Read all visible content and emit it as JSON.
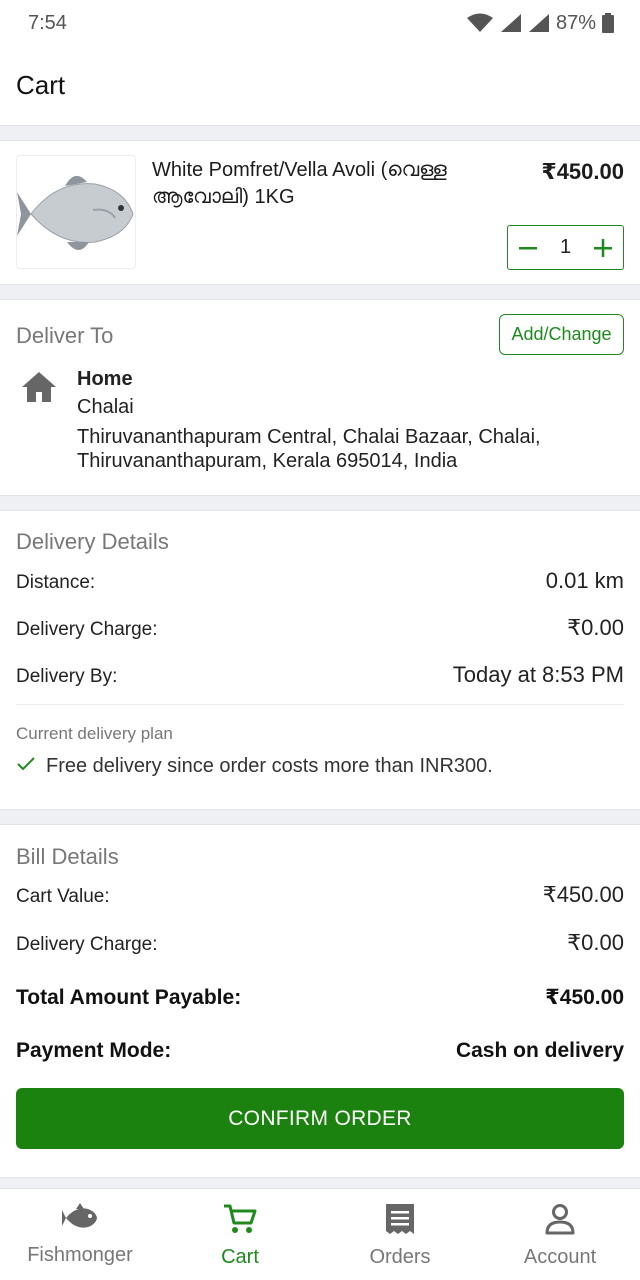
{
  "status_bar": {
    "time": "7:54",
    "battery": "87%"
  },
  "header": {
    "title": "Cart"
  },
  "cart_item": {
    "name": "White Pomfret/Vella Avoli (വെള്ള ആവോലി) 1KG",
    "price": "₹450.00",
    "quantity": "1"
  },
  "deliver_to": {
    "heading": "Deliver To",
    "action_label": "Add/Change",
    "label": "Home",
    "line1": "Chalai",
    "line2": "Thiruvananthapuram Central, Chalai Bazaar, Chalai, Thiruvananthapuram, Kerala 695014, India"
  },
  "delivery_details": {
    "heading": "Delivery Details",
    "rows": [
      {
        "label": "Distance:",
        "value": "0.01 km"
      },
      {
        "label": "Delivery Charge:",
        "value": "₹0.00"
      },
      {
        "label": "Delivery By:",
        "value": "Today at 8:53 PM"
      }
    ],
    "plan_caption": "Current delivery plan",
    "plan_text": "Free delivery since order costs more than INR300."
  },
  "bill_details": {
    "heading": "Bill Details",
    "rows": [
      {
        "label": "Cart Value:",
        "value": "₹450.00"
      },
      {
        "label": "Delivery Charge:",
        "value": "₹0.00"
      }
    ],
    "total_label": "Total Amount Payable:",
    "total_value": "₹450.00",
    "payment_label": "Payment Mode:",
    "payment_value": "Cash on delivery",
    "confirm_label": "CONFIRM ORDER"
  },
  "bottom_nav": [
    {
      "label": "Fishmonger",
      "icon": "fish-icon",
      "active": false
    },
    {
      "label": "Cart",
      "icon": "cart-icon",
      "active": true
    },
    {
      "label": "Orders",
      "icon": "receipt-icon",
      "active": false
    },
    {
      "label": "Account",
      "icon": "person-icon",
      "active": false
    }
  ],
  "colors": {
    "accent": "#1e8a1e",
    "confirm_button": "#1c820f",
    "muted_text": "#777777"
  }
}
